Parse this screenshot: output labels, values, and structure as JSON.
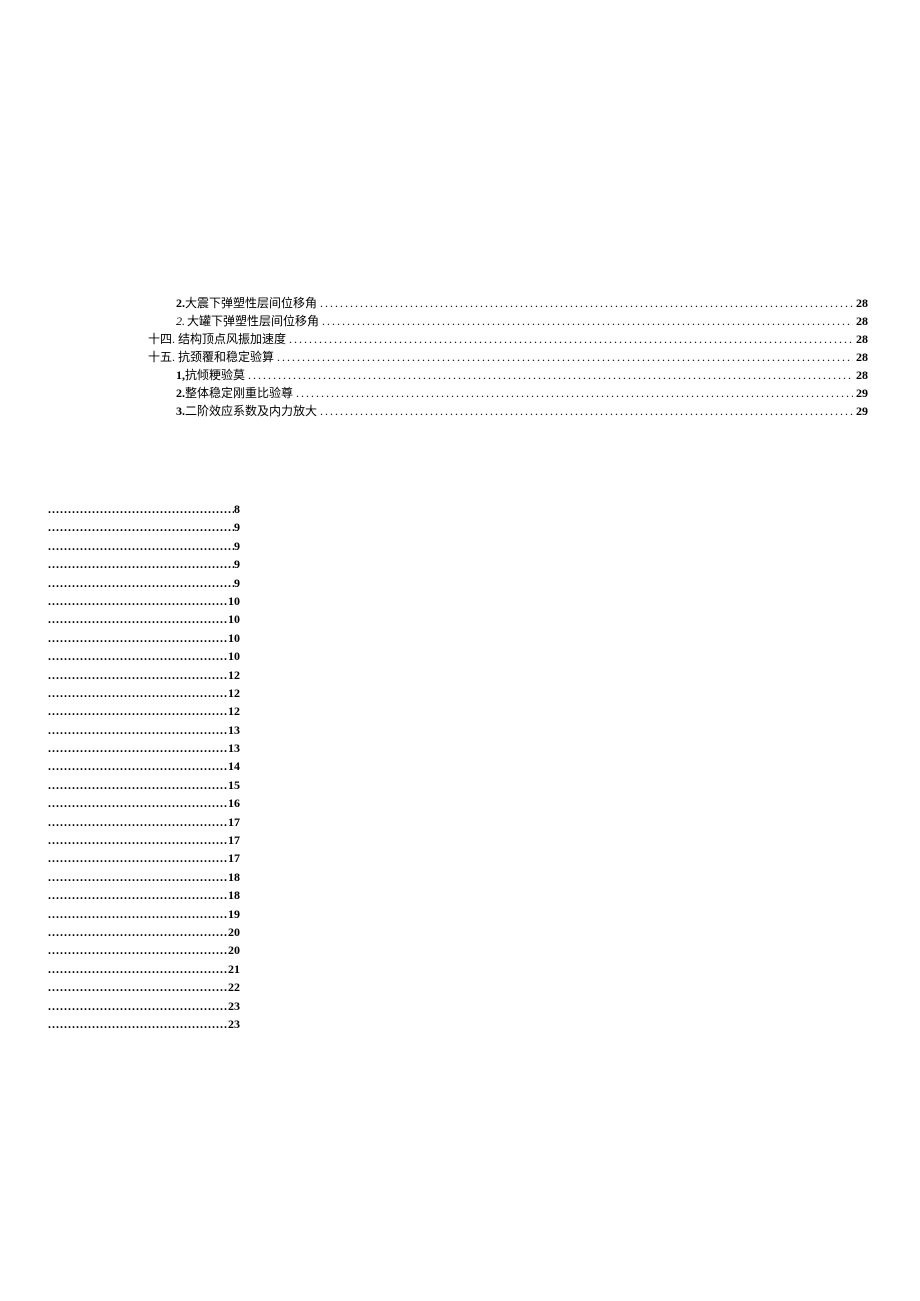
{
  "upper": [
    {
      "indent": "ind2",
      "prefix": "2.",
      "text": "大震下弹塑性层间位移角",
      "page": "28"
    },
    {
      "indent": "ind2",
      "prefix_italic": "2.",
      "text": "大罐下弹塑性层间位移角",
      "page": "28"
    },
    {
      "indent": "ind1",
      "prefix": "十四.",
      "text": "结构顶点风振加速度",
      "page": "28",
      "plainPrefix": true
    },
    {
      "indent": "ind1",
      "prefix": "十五.",
      "text": "抗颈覆和稳定验算",
      "page": "28",
      "plainPrefix": true
    },
    {
      "indent": "ind2",
      "prefix": "1,",
      "text": "抗倾粳验莫",
      "page": "28"
    },
    {
      "indent": "ind2",
      "prefix": "2.",
      "text": "整体稳定刚重比验尊",
      "page": "29"
    },
    {
      "indent": "ind2",
      "prefix": "3.",
      "text": "二阶效应系数及内力放大",
      "page": "29"
    }
  ],
  "lower": [
    "8",
    "9",
    "9",
    "9",
    "9",
    "10",
    "10",
    "10",
    "10",
    "12",
    "12",
    "12",
    "13",
    "13",
    "14",
    "15",
    "16",
    "17",
    "17",
    "17",
    "18",
    "18",
    "19",
    "20",
    "20",
    "21",
    "22",
    "23",
    "23"
  ]
}
